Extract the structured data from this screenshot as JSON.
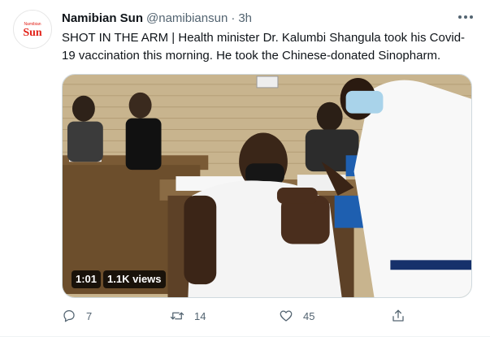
{
  "tweet": {
    "author": {
      "display_name": "Namibian Sun",
      "handle": "@namibiansun",
      "separator": "·",
      "time": "3h",
      "avatar_logo_text": "Sun",
      "avatar_logo_small": "Namibian"
    },
    "text": "SHOT IN THE ARM | Health minister Dr. Kalumbi Shangula took his Covid-19 vaccination this morning. He took the Chinese-donated Sinopharm.",
    "media": {
      "type": "video",
      "duration": "1:01",
      "views": "1.1K views"
    },
    "actions": {
      "replies": "7",
      "retweets": "14",
      "likes": "45"
    },
    "icons": {
      "more": "more-icon",
      "reply": "reply-icon",
      "retweet": "retweet-icon",
      "like": "heart-icon",
      "share": "share-icon"
    },
    "colors": {
      "text": "#0f1419",
      "secondary": "#536471",
      "logo_red": "#e2231a"
    }
  }
}
